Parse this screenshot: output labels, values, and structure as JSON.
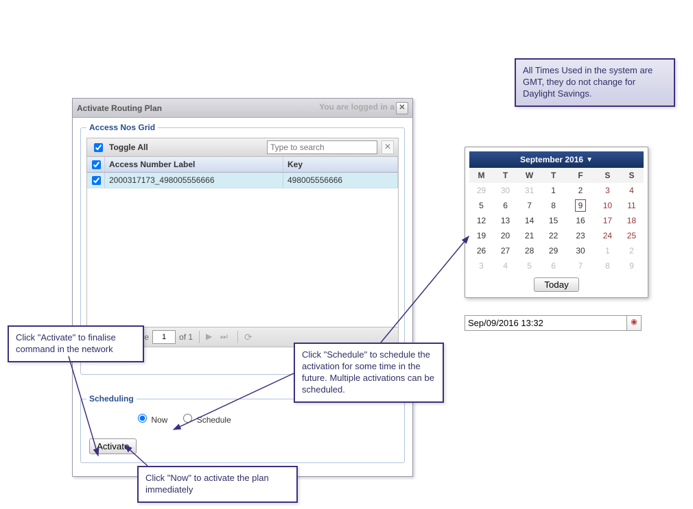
{
  "dialog": {
    "title": "Activate Routing Plan",
    "logged_label": "You are logged in a"
  },
  "grid": {
    "legend": "Access Nos Grid",
    "toggle_all": "Toggle All",
    "search_placeholder": "Type to search",
    "headers": {
      "label": "Access Number Label",
      "key": "Key"
    },
    "rows": [
      {
        "label": "2000317173_498005556666",
        "key": "498005556666"
      }
    ],
    "pager": {
      "page_label": "Page",
      "page_value": "1",
      "of_label": "of 1"
    }
  },
  "scheduling": {
    "legend": "Scheduling",
    "activate_btn": "Activate",
    "now_label": "Now",
    "schedule_label": "Schedule"
  },
  "callouts": {
    "gmt": "All Times Used in the system are GMT, they do not change for Daylight Savings.",
    "activate": "Click \"Activate\" to finalise command in the network",
    "schedule": "Click \"Schedule\" to schedule the activation for some time in the future. Multiple activations can be scheduled.",
    "now": "Click \"Now\" to activate the plan immediately"
  },
  "calendar": {
    "title": "September 2016",
    "dow": [
      "M",
      "T",
      "W",
      "T",
      "F",
      "S",
      "S"
    ],
    "weeks": [
      [
        {
          "d": "29",
          "m": true
        },
        {
          "d": "30",
          "m": true
        },
        {
          "d": "31",
          "m": true
        },
        {
          "d": "1"
        },
        {
          "d": "2"
        },
        {
          "d": "3",
          "w": true
        },
        {
          "d": "4",
          "w": true
        }
      ],
      [
        {
          "d": "5"
        },
        {
          "d": "6"
        },
        {
          "d": "7"
        },
        {
          "d": "8"
        },
        {
          "d": "9",
          "today": true
        },
        {
          "d": "10",
          "w": true
        },
        {
          "d": "11",
          "w": true
        }
      ],
      [
        {
          "d": "12"
        },
        {
          "d": "13"
        },
        {
          "d": "14"
        },
        {
          "d": "15"
        },
        {
          "d": "16"
        },
        {
          "d": "17",
          "w": true
        },
        {
          "d": "18",
          "w": true
        }
      ],
      [
        {
          "d": "19"
        },
        {
          "d": "20"
        },
        {
          "d": "21"
        },
        {
          "d": "22"
        },
        {
          "d": "23"
        },
        {
          "d": "24",
          "w": true
        },
        {
          "d": "25",
          "w": true
        }
      ],
      [
        {
          "d": "26"
        },
        {
          "d": "27"
        },
        {
          "d": "28"
        },
        {
          "d": "29"
        },
        {
          "d": "30"
        },
        {
          "d": "1",
          "m": true
        },
        {
          "d": "2",
          "m": true
        }
      ],
      [
        {
          "d": "3",
          "m": true
        },
        {
          "d": "4",
          "m": true
        },
        {
          "d": "5",
          "m": true
        },
        {
          "d": "6",
          "m": true
        },
        {
          "d": "7",
          "m": true
        },
        {
          "d": "8",
          "m": true
        },
        {
          "d": "9",
          "m": true
        }
      ]
    ],
    "today_btn": "Today",
    "datetime_value": "Sep/09/2016 13:32"
  }
}
